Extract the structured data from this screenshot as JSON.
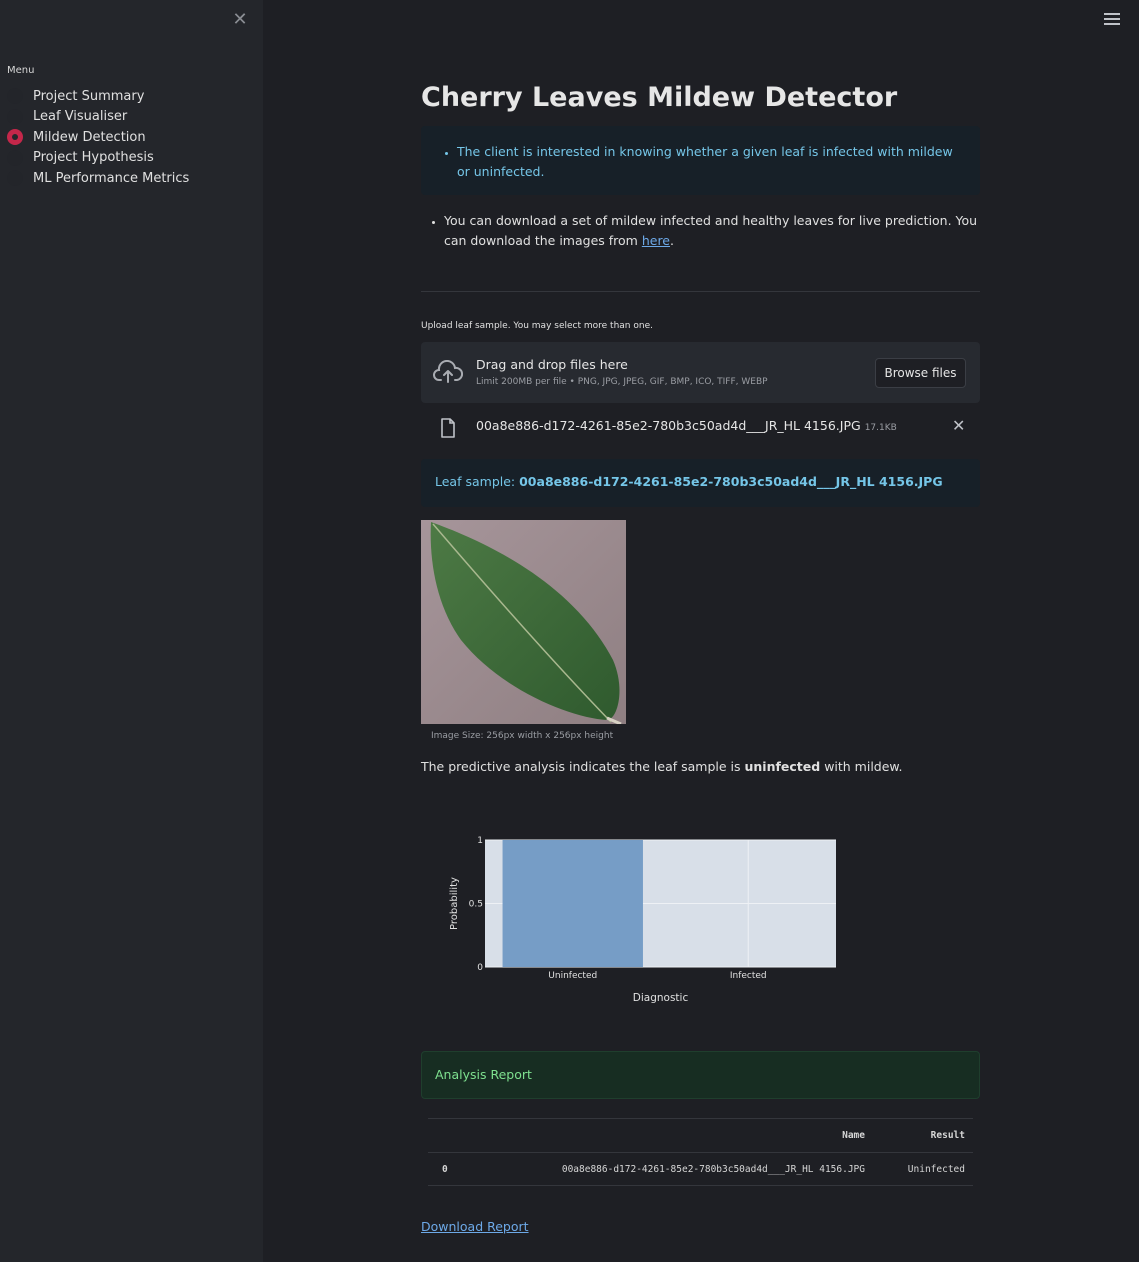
{
  "sidebar": {
    "menu_title": "Menu",
    "items": [
      {
        "label": "Project Summary",
        "selected": false
      },
      {
        "label": "Leaf Visualiser",
        "selected": false
      },
      {
        "label": "Mildew Detection",
        "selected": true
      },
      {
        "label": "Project Hypothesis",
        "selected": false
      },
      {
        "label": "ML Performance Metrics",
        "selected": false
      }
    ]
  },
  "page": {
    "title": "Cherry Leaves Mildew Detector",
    "info_text": "The client is interested in knowing whether a given leaf is infected with mildew or uninfected.",
    "download_text_before": "You can download a set of mildew infected and healthy leaves for live prediction. You can download the images from ",
    "download_link_label": "here",
    "download_text_after": "."
  },
  "uploader": {
    "label": "Upload leaf sample. You may select more than one.",
    "drop_title": "Drag and drop files here",
    "drop_subtitle": "Limit 200MB per file • PNG, JPG, JPEG, GIF, BMP, ICO, TIFF, WEBP",
    "browse_label": "Browse files",
    "file_name": "00a8e886-d172-4261-85e2-780b3c50ad4d___JR_HL 4156.JPG",
    "file_size": "17.1KB"
  },
  "sample": {
    "prefix": "Leaf sample: ",
    "name": "00a8e886-d172-4261-85e2-780b3c50ad4d___JR_HL 4156.JPG",
    "caption": "Image Size: 256px width x 256px height",
    "analysis_before": "The predictive analysis indicates the leaf sample is ",
    "analysis_result": "uninfected",
    "analysis_after": " with mildew."
  },
  "chart_data": {
    "type": "bar",
    "categories": [
      "Uninfected",
      "Infected"
    ],
    "values": [
      1,
      0
    ],
    "xlabel": "Diagnostic",
    "ylabel": "Probability",
    "ylim": [
      0,
      1
    ],
    "yticks": [
      "0",
      "0.5",
      "1"
    ],
    "grid": true,
    "colors": {
      "bar": "#769dc6",
      "plot_bg": "#d8dfe8"
    }
  },
  "report": {
    "title": "Analysis Report",
    "columns": [
      "",
      "Name",
      "Result"
    ],
    "rows": [
      [
        "0",
        "00a8e886-d172-4261-85e2-780b3c50ad4d___JR_HL 4156.JPG",
        "Uninfected"
      ]
    ],
    "download_label": "Download Report"
  },
  "colors": {
    "accent": "#c4274a",
    "info_text": "#75c6e8",
    "success_text": "#7ee08f",
    "link": "#6da9e8"
  }
}
